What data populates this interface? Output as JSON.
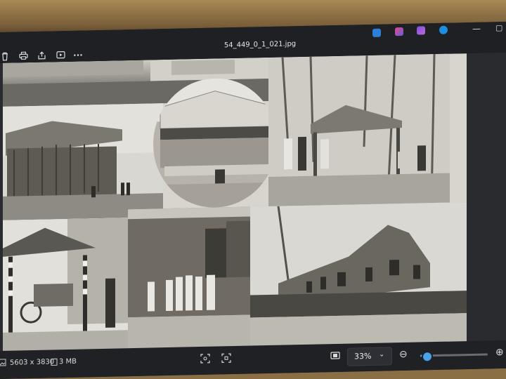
{
  "window": {
    "title": "54_449_0_1_021.jpg"
  },
  "toolbar": {
    "icons": [
      "delete-icon",
      "print-icon",
      "share-icon",
      "slideshow-icon",
      "more-icon"
    ],
    "more_label": "···"
  },
  "taskbar_apps": [
    "app-icon-1",
    "app-icon-2",
    "app-icon-3",
    "app-icon-4"
  ],
  "window_controls": {
    "minimize": "—",
    "maximize": "▢"
  },
  "status": {
    "dimensions": "5603 x 3830",
    "size": "3 MB",
    "zoom": "33%",
    "zoom_chevron": "⌄",
    "zoom_level": 0.1,
    "zoom_out": "⊖",
    "zoom_in": "⊕"
  },
  "colors": {
    "accent": "#4aa3e8",
    "titlebar": "#1f2024",
    "statusbar": "#202125",
    "photo_background": "#d8d5cf"
  }
}
